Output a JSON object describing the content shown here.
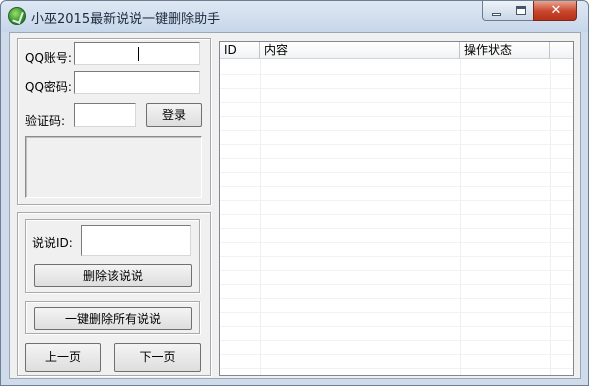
{
  "window": {
    "title": "小巫2015最新说说一键删除助手",
    "controls": {
      "minimize": "minimize",
      "maximize": "maximize",
      "close": "✕"
    }
  },
  "login": {
    "qq_label": "QQ账号:",
    "qq_value": "",
    "password_label": "QQ密码:",
    "password_value": "",
    "captcha_label": "验证码:",
    "captcha_value": "",
    "login_button": "登录"
  },
  "actions": {
    "shuoshuo_id_label": "说说ID:",
    "shuoshuo_id_value": "",
    "delete_one_button": "删除该说说",
    "delete_all_button": "一键删除所有说说",
    "prev_page_button": "上一页",
    "next_page_button": "下一页"
  },
  "list": {
    "columns": [
      "ID",
      "内容",
      "操作状态"
    ],
    "rows": []
  },
  "colors": {
    "title_bar": "#c6d6ea",
    "close_button": "#c8452d",
    "client_background": "#f0f0f0"
  }
}
